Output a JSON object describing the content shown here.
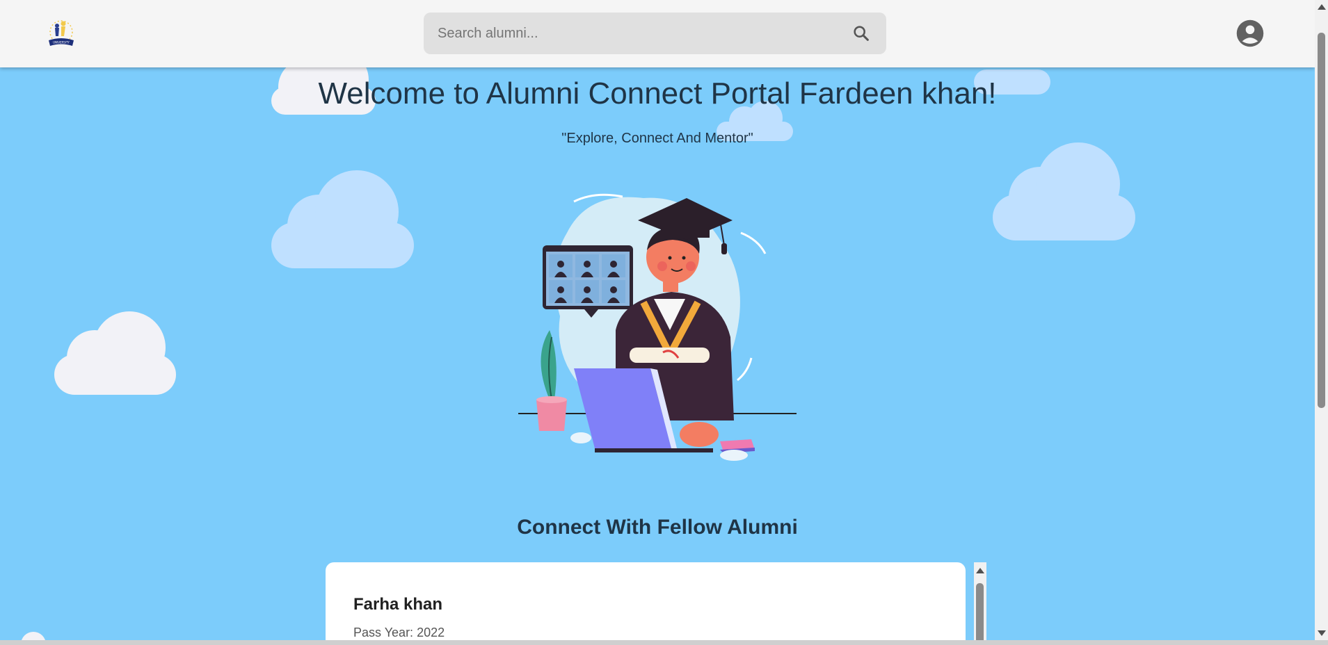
{
  "header": {
    "logo_alt": "University logo",
    "search": {
      "placeholder": "Search alumni...",
      "value": ""
    },
    "icons": {
      "search": "search-icon",
      "account": "account-circle-icon"
    }
  },
  "hero": {
    "title": "Welcome to Alumni Connect Portal Fardeen khan!",
    "subtitle": "\"Explore, Connect And Mentor\""
  },
  "alumni_section": {
    "heading": "Connect With Fellow Alumni",
    "cards": [
      {
        "name": "Farha khan",
        "pass_year": "Pass Year: 2022"
      }
    ]
  },
  "colors": {
    "background": "#7cccfb",
    "appbar": "#f5f5f5",
    "search_bg": "#e0e0e0",
    "text_dark": "#1f3446",
    "card_bg": "#ffffff"
  }
}
